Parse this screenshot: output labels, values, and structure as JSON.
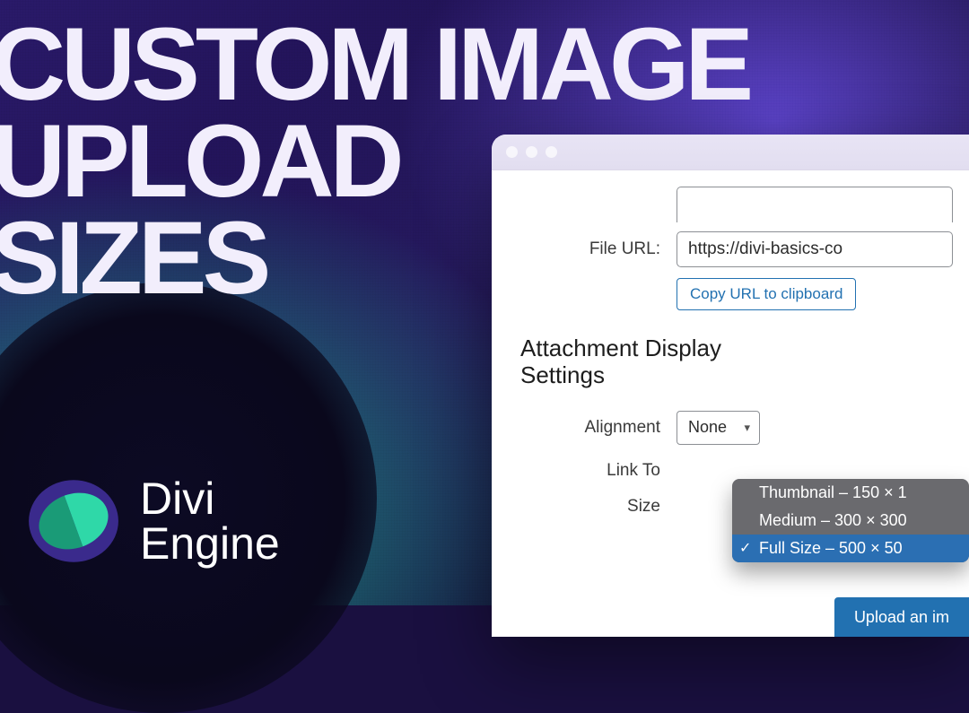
{
  "headline": {
    "line1": "CUSTOM IMAGE",
    "line2": "UPLOAD",
    "line3": "SIZES"
  },
  "brand": {
    "name_line1": "Divi",
    "name_line2": "Engine",
    "colors": {
      "purple": "#3a2a8c",
      "teal": "#2fd8a8"
    }
  },
  "wp": {
    "file_url_label": "File URL:",
    "file_url_value": "https://divi-basics-co",
    "copy_button": "Copy URL to clipboard",
    "section_title_line1": "Attachment Display",
    "section_title_line2": "Settings",
    "alignment_label": "Alignment",
    "alignment_value": "None",
    "link_to_label": "Link To",
    "size_label": "Size",
    "size_options": [
      {
        "label": "Thumbnail – 150 × 1",
        "selected": false
      },
      {
        "label": "Medium – 300 × 300",
        "selected": false
      },
      {
        "label": "Full Size – 500 × 50",
        "selected": true
      }
    ],
    "upload_button": "Upload an im"
  }
}
